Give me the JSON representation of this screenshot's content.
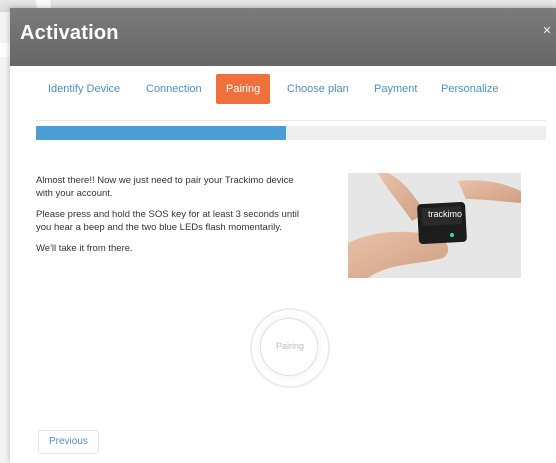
{
  "modal": {
    "title": "Activation",
    "close_icon": "close-icon"
  },
  "tabs": [
    {
      "label": "Identify Device",
      "active": false
    },
    {
      "label": "Connection",
      "active": false
    },
    {
      "label": "Pairing",
      "active": true
    },
    {
      "label": "Choose plan",
      "active": false
    },
    {
      "label": "Payment",
      "active": false
    },
    {
      "label": "Personalize",
      "active": false
    }
  ],
  "progress": {
    "fraction": 0.49,
    "color": "#4b9fd6"
  },
  "content": {
    "p1": "Almost there!! Now we just need to pair your Trackimo device with your account.",
    "p2": "Please press and hold the SOS key for at least 3 seconds until you hear a beep and the two blue LEDs flash momentarily.",
    "p3": "We'll take it from there."
  },
  "photo": {
    "device_label": "trackimo"
  },
  "spinner": {
    "label": "Pairing"
  },
  "buttons": {
    "previous": "Previous"
  },
  "colors": {
    "accent": "#f0703c",
    "link": "#4a90c8",
    "header": "#707070"
  }
}
